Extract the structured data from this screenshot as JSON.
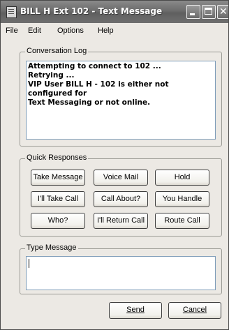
{
  "window": {
    "title": "BILL H Ext 102 - Text Message"
  },
  "menu": {
    "items": [
      "File",
      "Edit",
      "Options",
      "Help"
    ]
  },
  "conversation_log": {
    "label": "Conversation Log",
    "lines": [
      "Attempting to connect to 102 ...",
      "Retrying ...",
      "VIP User BILL H  - 102 is either not configured for",
      "Text Messaging or not online."
    ]
  },
  "quick_responses": {
    "label": "Quick Responses",
    "buttons": [
      "Take Message",
      "Voice Mail",
      "Hold",
      "I'll Take Call",
      "Call About?",
      "You Handle",
      "Who?",
      "I'll Return Call",
      "Route Call"
    ]
  },
  "type_message": {
    "label": "Type Message",
    "value": ""
  },
  "actions": {
    "send_label": "Send",
    "cancel_label": "Cancel"
  }
}
